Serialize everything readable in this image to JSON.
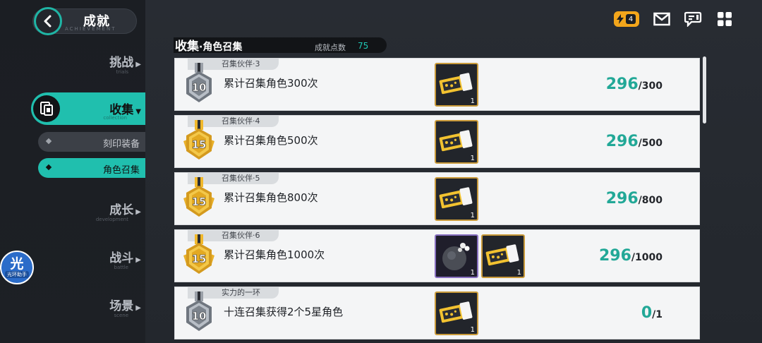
{
  "header": {
    "title": "成就",
    "title_en": "ACHIEVEMENT",
    "energy_count": "4"
  },
  "nav": {
    "items": [
      {
        "label": "挑战",
        "sub": "trials"
      },
      {
        "label": "收集",
        "sub": "collection"
      },
      {
        "label": "成长",
        "sub": "development"
      },
      {
        "label": "战斗",
        "sub": "battle"
      },
      {
        "label": "场景",
        "sub": "scene"
      }
    ],
    "sub_items": [
      {
        "label": "刻印装备"
      },
      {
        "label": "角色召集"
      }
    ]
  },
  "helper": {
    "icon_text": "光",
    "label": "光环助手"
  },
  "section": {
    "title": "收集",
    "subtitle": "角色召集",
    "points_label": "成就点数",
    "points_value": "75"
  },
  "achievements": [
    {
      "tag": "召集伙伴·3",
      "desc": "累计召集角色300次",
      "medal": "10",
      "medal_type": "silver",
      "current": "296",
      "target": "/300",
      "rewards": [
        {
          "icon": "ticket-icon",
          "count": "1"
        }
      ]
    },
    {
      "tag": "召集伙伴·4",
      "desc": "累计召集角色500次",
      "medal": "15",
      "medal_type": "gold",
      "current": "296",
      "target": "/500",
      "rewards": [
        {
          "icon": "ticket-icon",
          "count": "1"
        }
      ]
    },
    {
      "tag": "召集伙伴·5",
      "desc": "累计召集角色800次",
      "medal": "15",
      "medal_type": "gold",
      "current": "296",
      "target": "/800",
      "rewards": [
        {
          "icon": "ticket-icon",
          "count": "1"
        }
      ]
    },
    {
      "tag": "召集伙伴·6",
      "desc": "累计召集角色1000次",
      "medal": "15",
      "medal_type": "gold",
      "current": "296",
      "target": "/1000",
      "rewards": [
        {
          "icon": "orb-icon",
          "count": "1"
        },
        {
          "icon": "ticket-icon",
          "count": "1"
        }
      ]
    },
    {
      "tag": "实力的一环",
      "desc": "十连召集获得2个5星角色",
      "medal": "10",
      "medal_type": "silver",
      "current": "0",
      "target": "/1",
      "rewards": [
        {
          "icon": "ticket-icon",
          "count": "1"
        }
      ]
    }
  ],
  "colors": {
    "accent": "#20bfae",
    "progress": "#22a897",
    "gold": "#e9b02b",
    "silver": "#8a9099"
  }
}
